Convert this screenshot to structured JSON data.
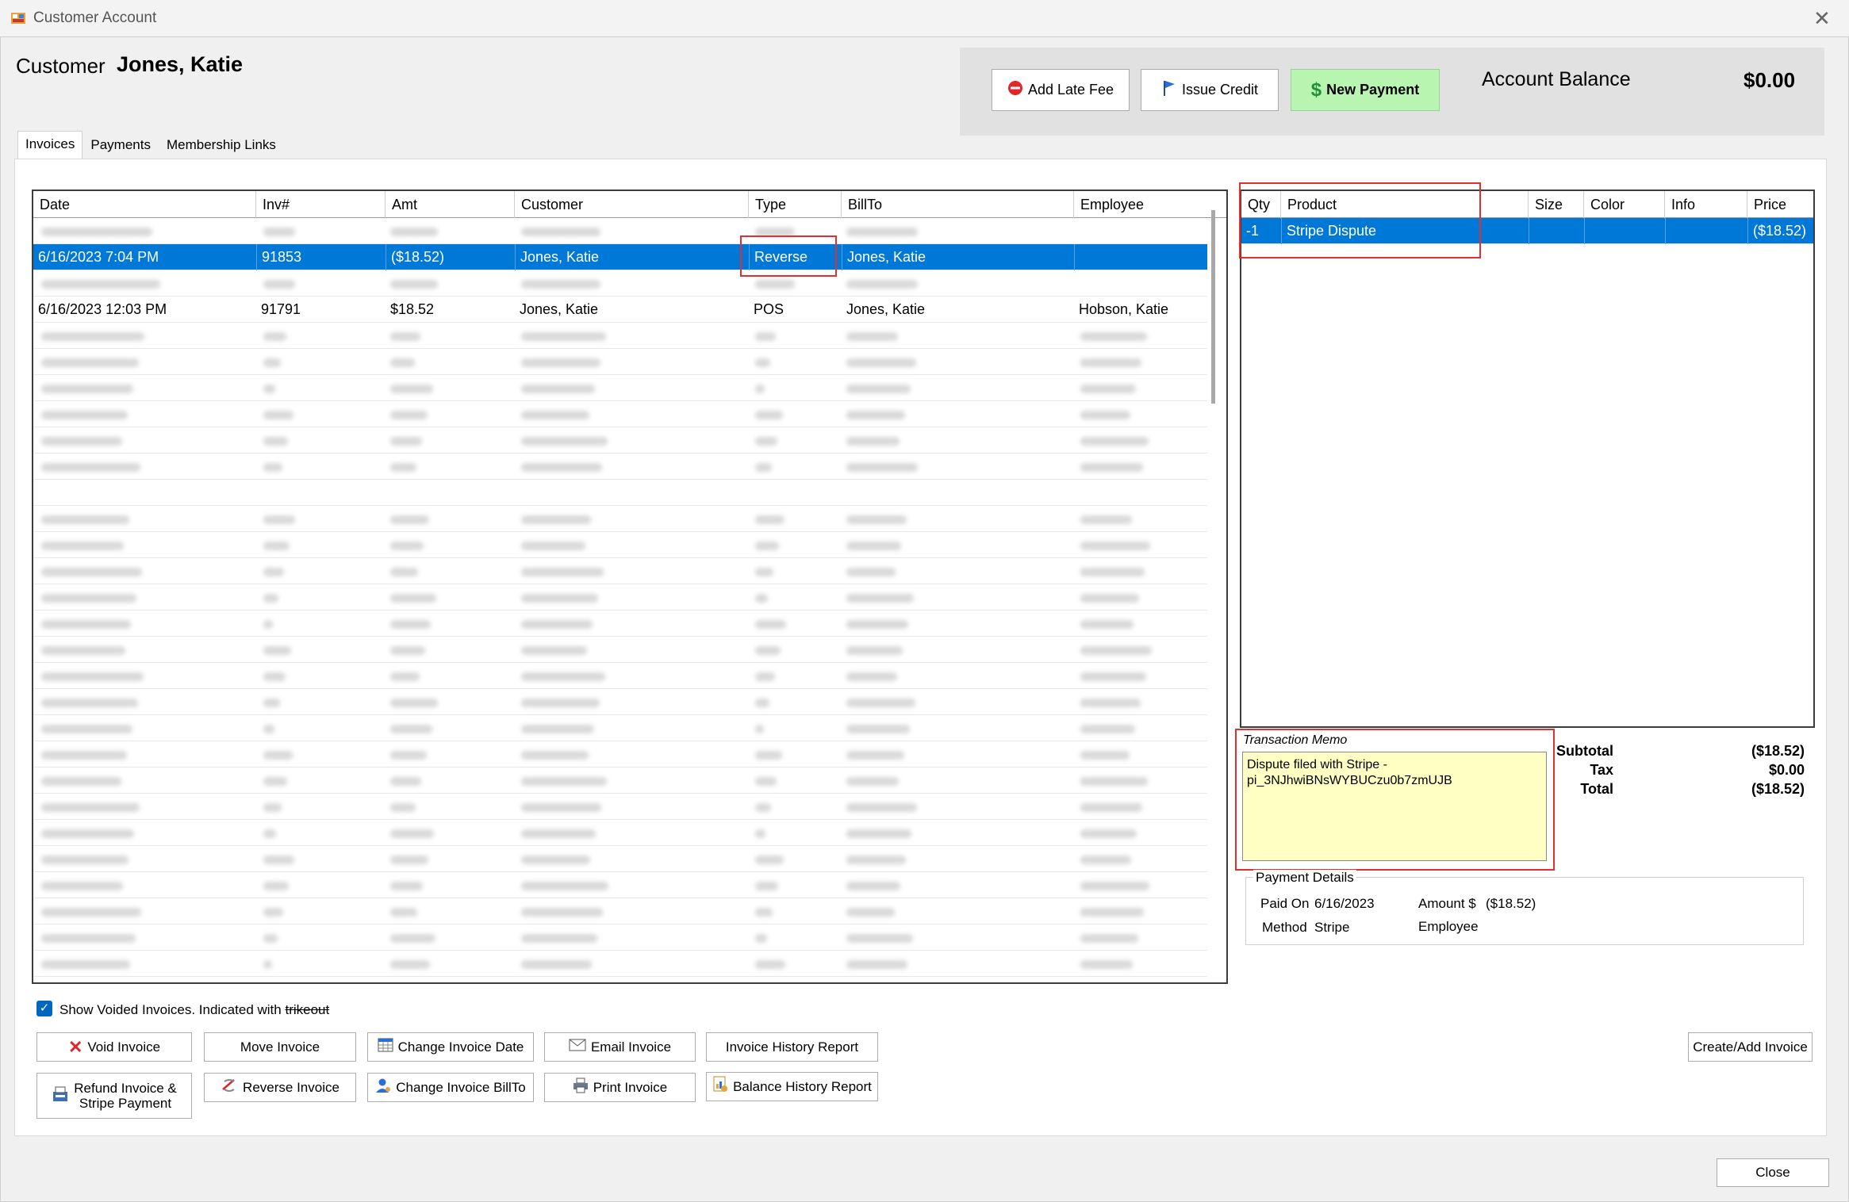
{
  "window": {
    "title": "Customer Account",
    "close_symbol": "✕"
  },
  "customer": {
    "label": "Customer",
    "name": "Jones, Katie"
  },
  "actions": {
    "add_late_fee": "Add Late Fee",
    "issue_credit": "Issue Credit",
    "new_payment": "New Payment"
  },
  "balance": {
    "label": "Account Balance",
    "value": "$0.00"
  },
  "tabs": [
    {
      "label": "Invoices",
      "active": true
    },
    {
      "label": "Payments",
      "active": false
    },
    {
      "label": "Membership Links",
      "active": false
    }
  ],
  "invoice_grid": {
    "columns": [
      "Date",
      "Inv#",
      "Amt",
      "Customer",
      "Type",
      "BillTo",
      "Employee"
    ],
    "rows": [
      {
        "date": "6/16/2023 7:04 PM",
        "inv": "91853",
        "amt": "($18.52)",
        "customer": "Jones, Katie",
        "type": "Reverse",
        "billto": "Jones, Katie",
        "employee": "",
        "selected": true
      },
      {
        "date": "6/16/2023 12:03 PM",
        "inv": "91791",
        "amt": "$18.52",
        "customer": "Jones, Katie",
        "type": "POS",
        "billto": "Jones, Katie",
        "employee": "Hobson, Katie",
        "selected": false
      }
    ]
  },
  "product_grid": {
    "columns": [
      "Qty",
      "Product",
      "Size",
      "Color",
      "Info",
      "Price"
    ],
    "rows": [
      {
        "qty": "-1",
        "product": "Stripe Dispute",
        "size": "",
        "color": "",
        "info": "",
        "price": "($18.52)",
        "selected": true
      }
    ]
  },
  "memo": {
    "label": "Transaction Memo",
    "line1": "Dispute filed with Stripe -",
    "line2": "pi_3NJhwiBNsWYBUCzu0b7zmUJB"
  },
  "totals": {
    "subtotal_label": "Subtotal",
    "subtotal": "($18.52)",
    "tax_label": "Tax",
    "tax": "$0.00",
    "total_label": "Total",
    "total": "($18.52)"
  },
  "payment_details": {
    "legend": "Payment Details",
    "paid_on_label": "Paid On",
    "paid_on": "6/16/2023",
    "amount_label": "Amount $",
    "amount": "($18.52)",
    "method_label": "Method",
    "method": "Stripe",
    "employee_label": "Employee"
  },
  "voided": {
    "checked": true,
    "label": "Show Voided Invoices. Indicated with",
    "strike_text": "trikeout"
  },
  "buttons": {
    "void": "Void Invoice",
    "move": "Move Invoice",
    "change_date": "Change Invoice Date",
    "email": "Email Invoice",
    "history": "Invoice History Report",
    "refund_line1": "Refund Invoice &",
    "refund_line2": "Stripe Payment",
    "reverse": "Reverse Invoice",
    "change_billto": "Change Invoice BillTo",
    "print": "Print Invoice",
    "balance_history": "Balance History Report",
    "create_add": "Create/Add Invoice",
    "close": "Close"
  },
  "colors": {
    "selection": "#0078d7",
    "highlight_box": "#e03030",
    "memo_bg": "#ffffc4",
    "new_payment_bg": "#b8f5b0"
  }
}
